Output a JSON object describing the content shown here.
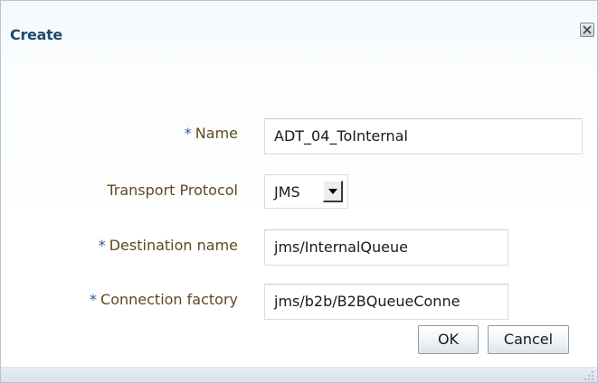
{
  "dialog": {
    "title": "Create",
    "close_icon": "close-icon"
  },
  "form": {
    "required_marker": "*",
    "name": {
      "label": "Name",
      "value": "ADT_04_ToInternal",
      "required": true
    },
    "transport_protocol": {
      "label": "Transport Protocol",
      "selected": "JMS",
      "required": false
    },
    "destination_name": {
      "label": "Destination name",
      "value": "jms/InternalQueue",
      "required": true
    },
    "connection_factory": {
      "label": "Connection factory",
      "value": "jms/b2b/B2BQueueConne",
      "required": true
    }
  },
  "buttons": {
    "ok": "OK",
    "cancel": "Cancel"
  },
  "colors": {
    "title": "#1d4a73",
    "label": "#5c4b1f",
    "required_marker": "#2a5a8c"
  }
}
